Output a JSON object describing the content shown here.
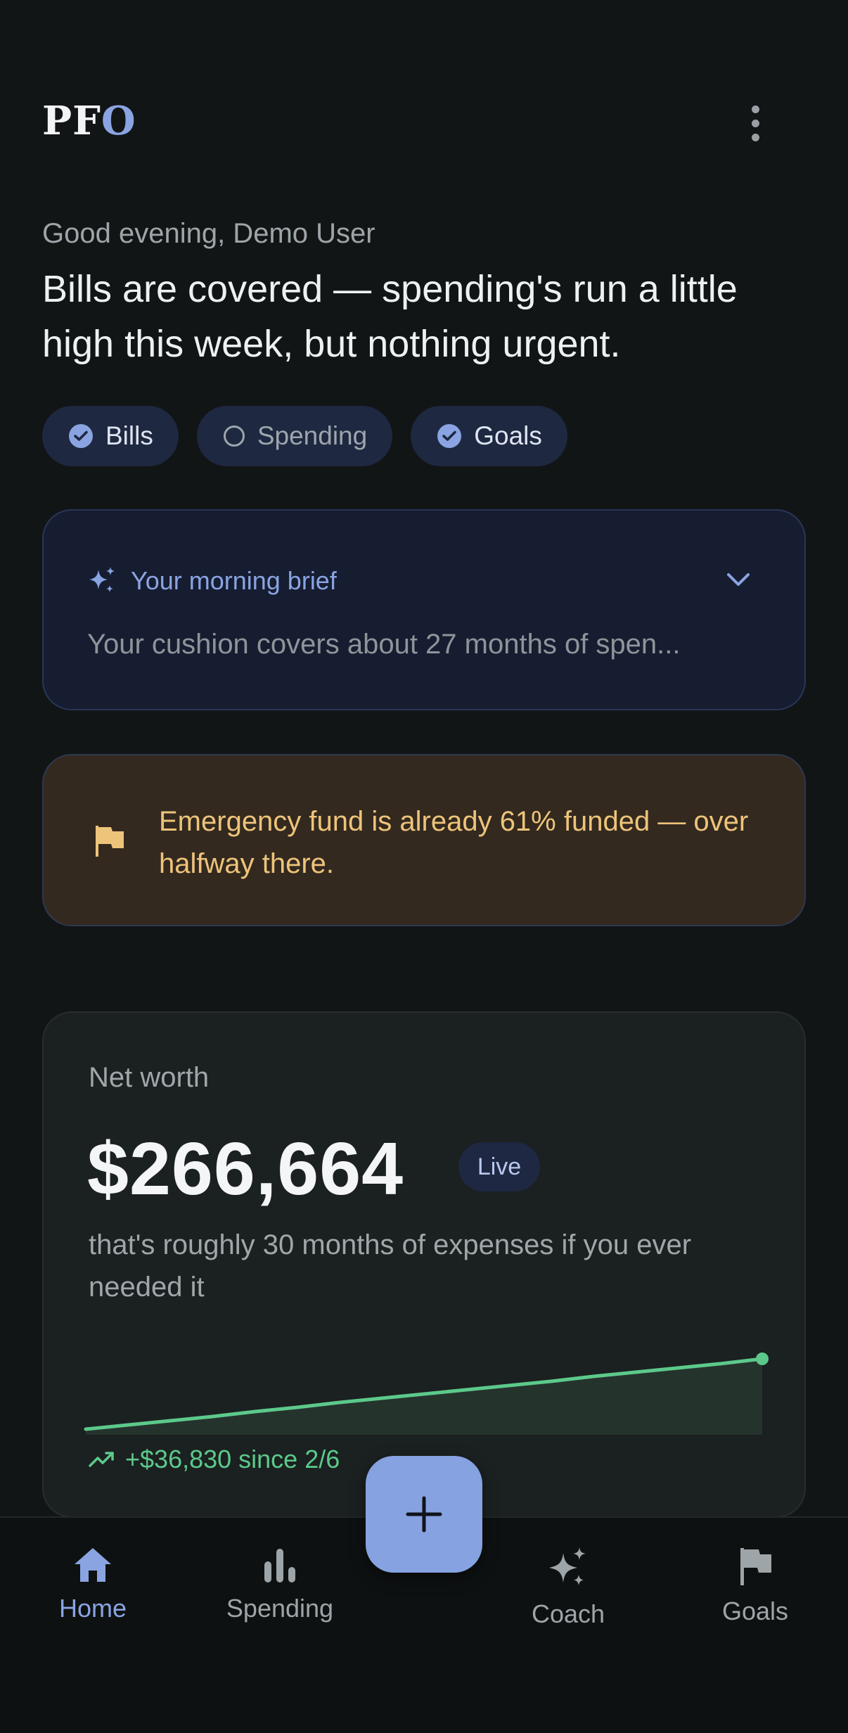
{
  "app": {
    "logo_main": "PF",
    "logo_accent": "O"
  },
  "header": {
    "greeting": "Good evening, Demo User",
    "headline": "Bills are covered — spending's run a little high this week, but nothing urgent."
  },
  "chips": [
    {
      "label": "Bills",
      "checked": true
    },
    {
      "label": "Spending",
      "checked": false
    },
    {
      "label": "Goals",
      "checked": true
    }
  ],
  "brief": {
    "title": "Your morning brief",
    "text": "Your cushion covers about 27 months of spen..."
  },
  "alert": {
    "text": "Emergency fund is already 61% funded — over halfway there.",
    "icon": "flag-icon"
  },
  "net_worth": {
    "label": "Net worth",
    "value": "$266,664",
    "badge": "Live",
    "subtitle": "that's roughly 30 months of expenses if you ever needed it",
    "delta": "+$36,830 since 2/6",
    "trend": [
      0.0,
      0.06,
      0.12,
      0.18,
      0.25,
      0.31,
      0.38,
      0.44,
      0.5,
      0.56,
      0.62,
      0.68,
      0.75,
      0.81,
      0.87,
      0.93,
      1.0
    ]
  },
  "fab": {
    "icon": "plus-icon"
  },
  "nav": [
    {
      "label": "Home",
      "icon": "home-icon",
      "active": true
    },
    {
      "label": "Spending",
      "icon": "bar-chart-icon",
      "active": false
    },
    {
      "label": "Coach",
      "icon": "sparkle-icon",
      "active": false
    },
    {
      "label": "Goals",
      "icon": "flag-icon",
      "active": false
    }
  ],
  "colors": {
    "accent": "#8aa4e2",
    "positive": "#5cc98b",
    "warning": "#eec47a",
    "background": "#121516"
  }
}
